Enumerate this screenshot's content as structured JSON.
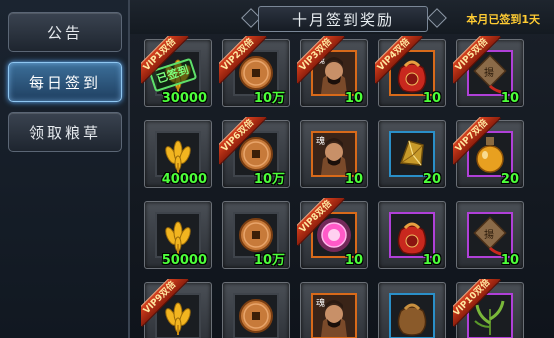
{
  "sidebar": {
    "items": [
      {
        "label": "公告"
      },
      {
        "label": "每日签到"
      },
      {
        "label": "领取粮草"
      }
    ]
  },
  "header": {
    "title": "十月签到奖励",
    "signed_status": "本月已签到1天"
  },
  "rewards": [
    {
      "vip": "VIP1双倍",
      "qty": "30000",
      "icon": "grain-icon",
      "frame": "gray",
      "stamp": "已签到"
    },
    {
      "vip": "VIP2双倍",
      "qty": "10万",
      "icon": "coin-icon",
      "frame": "gray"
    },
    {
      "vip": "VIP3双倍",
      "qty": "10",
      "icon": "general-portrait-icon",
      "frame": "orange"
    },
    {
      "vip": "VIP4双倍",
      "qty": "10",
      "icon": "red-pouch-icon",
      "frame": "orange"
    },
    {
      "vip": "VIP5双倍",
      "qty": "10",
      "icon": "token-plaque-icon",
      "frame": "purple"
    },
    {
      "vip": "",
      "qty": "40000",
      "icon": "grain-icon",
      "frame": "gray"
    },
    {
      "vip": "VIP6双倍",
      "qty": "10万",
      "icon": "coin-icon",
      "frame": "gray"
    },
    {
      "vip": "",
      "qty": "10",
      "icon": "general-portrait-icon",
      "frame": "orange"
    },
    {
      "vip": "",
      "qty": "20",
      "icon": "gold-crystal-icon",
      "frame": "blue"
    },
    {
      "vip": "VIP7双倍",
      "qty": "20",
      "icon": "potion-flask-icon",
      "frame": "purple"
    },
    {
      "vip": "",
      "qty": "50000",
      "icon": "grain-icon",
      "frame": "gray"
    },
    {
      "vip": "",
      "qty": "10万",
      "icon": "coin-icon",
      "frame": "gray"
    },
    {
      "vip": "VIP8双倍",
      "qty": "10",
      "icon": "pink-orb-icon",
      "frame": "orange"
    },
    {
      "vip": "",
      "qty": "10",
      "icon": "red-pouch-icon",
      "frame": "purple"
    },
    {
      "vip": "",
      "qty": "10",
      "icon": "token-plaque-icon",
      "frame": "purple"
    },
    {
      "vip": "VIP9双倍",
      "qty": "",
      "icon": "grain-icon",
      "frame": "gray"
    },
    {
      "vip": "",
      "qty": "",
      "icon": "coin-icon",
      "frame": "gray"
    },
    {
      "vip": "",
      "qty": "",
      "icon": "general-portrait-icon",
      "frame": "orange"
    },
    {
      "vip": "",
      "qty": "",
      "icon": "brown-pouch-icon",
      "frame": "blue"
    },
    {
      "vip": "VIP10双倍",
      "qty": "",
      "icon": "herb-plant-icon",
      "frame": "purple"
    }
  ],
  "colors": {
    "quantity": "#4dff3a",
    "status_text": "#ffcc33",
    "ribbon": "#c0351a"
  }
}
